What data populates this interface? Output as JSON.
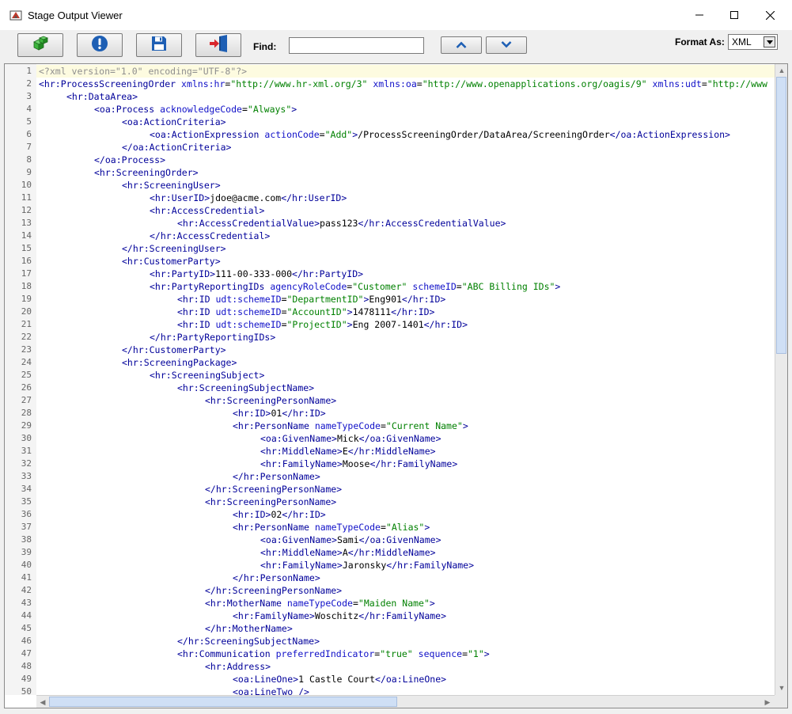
{
  "window": {
    "title": "Stage Output Viewer"
  },
  "toolbar": {
    "find_label": "Find:",
    "find_value": "",
    "format_label": "Format As:",
    "format_value": "XML"
  },
  "editor": {
    "lines": [
      {
        "n": "1",
        "indent": 0,
        "segs": [
          [
            "p",
            "<?xml version=\"1.0\" encoding=\"UTF-8\"?>"
          ]
        ]
      },
      {
        "n": "2",
        "indent": 0,
        "segs": [
          [
            "t",
            "<hr:ProcessScreeningOrder "
          ],
          [
            "a",
            "xmlns:hr"
          ],
          [
            "x",
            "="
          ],
          [
            "v",
            "\"http://www.hr-xml.org/3\""
          ],
          [
            "x",
            " "
          ],
          [
            "a",
            "xmlns:oa"
          ],
          [
            "x",
            "="
          ],
          [
            "v",
            "\"http://www.openapplications.org/oagis/9\""
          ],
          [
            "x",
            " "
          ],
          [
            "a",
            "xmlns:udt"
          ],
          [
            "x",
            "="
          ],
          [
            "v",
            "\"http://www"
          ]
        ]
      },
      {
        "n": "3",
        "indent": 1,
        "segs": [
          [
            "t",
            "<hr:DataArea>"
          ]
        ]
      },
      {
        "n": "4",
        "indent": 2,
        "segs": [
          [
            "t",
            "<oa:Process "
          ],
          [
            "a",
            "acknowledgeCode"
          ],
          [
            "x",
            "="
          ],
          [
            "v",
            "\"Always\""
          ],
          [
            "t",
            ">"
          ]
        ]
      },
      {
        "n": "5",
        "indent": 3,
        "segs": [
          [
            "t",
            "<oa:ActionCriteria>"
          ]
        ]
      },
      {
        "n": "6",
        "indent": 4,
        "segs": [
          [
            "t",
            "<oa:ActionExpression "
          ],
          [
            "a",
            "actionCode"
          ],
          [
            "x",
            "="
          ],
          [
            "v",
            "\"Add\""
          ],
          [
            "t",
            ">"
          ],
          [
            "x",
            "/ProcessScreeningOrder/DataArea/ScreeningOrder"
          ],
          [
            "t",
            "</oa:ActionExpression>"
          ]
        ]
      },
      {
        "n": "7",
        "indent": 3,
        "segs": [
          [
            "t",
            "</oa:ActionCriteria>"
          ]
        ]
      },
      {
        "n": "8",
        "indent": 2,
        "segs": [
          [
            "t",
            "</oa:Process>"
          ]
        ]
      },
      {
        "n": "9",
        "indent": 2,
        "segs": [
          [
            "t",
            "<hr:ScreeningOrder>"
          ]
        ]
      },
      {
        "n": "10",
        "indent": 3,
        "segs": [
          [
            "t",
            "<hr:ScreeningUser>"
          ]
        ]
      },
      {
        "n": "11",
        "indent": 4,
        "segs": [
          [
            "t",
            "<hr:UserID>"
          ],
          [
            "x",
            "jdoe@acme.com"
          ],
          [
            "t",
            "</hr:UserID>"
          ]
        ]
      },
      {
        "n": "12",
        "indent": 4,
        "segs": [
          [
            "t",
            "<hr:AccessCredential>"
          ]
        ]
      },
      {
        "n": "13",
        "indent": 5,
        "segs": [
          [
            "t",
            "<hr:AccessCredentialValue>"
          ],
          [
            "x",
            "pass123"
          ],
          [
            "t",
            "</hr:AccessCredentialValue>"
          ]
        ]
      },
      {
        "n": "14",
        "indent": 4,
        "segs": [
          [
            "t",
            "</hr:AccessCredential>"
          ]
        ]
      },
      {
        "n": "15",
        "indent": 3,
        "segs": [
          [
            "t",
            "</hr:ScreeningUser>"
          ]
        ]
      },
      {
        "n": "16",
        "indent": 3,
        "segs": [
          [
            "t",
            "<hr:CustomerParty>"
          ]
        ]
      },
      {
        "n": "17",
        "indent": 4,
        "segs": [
          [
            "t",
            "<hr:PartyID>"
          ],
          [
            "x",
            "111-00-333-000"
          ],
          [
            "t",
            "</hr:PartyID>"
          ]
        ]
      },
      {
        "n": "18",
        "indent": 4,
        "segs": [
          [
            "t",
            "<hr:PartyReportingIDs "
          ],
          [
            "a",
            "agencyRoleCode"
          ],
          [
            "x",
            "="
          ],
          [
            "v",
            "\"Customer\""
          ],
          [
            "x",
            " "
          ],
          [
            "a",
            "schemeID"
          ],
          [
            "x",
            "="
          ],
          [
            "v",
            "\"ABC Billing IDs\""
          ],
          [
            "t",
            ">"
          ]
        ]
      },
      {
        "n": "19",
        "indent": 5,
        "segs": [
          [
            "t",
            "<hr:ID "
          ],
          [
            "a",
            "udt:schemeID"
          ],
          [
            "x",
            "="
          ],
          [
            "v",
            "\"DepartmentID\""
          ],
          [
            "t",
            ">"
          ],
          [
            "x",
            "Eng901"
          ],
          [
            "t",
            "</hr:ID>"
          ]
        ]
      },
      {
        "n": "20",
        "indent": 5,
        "segs": [
          [
            "t",
            "<hr:ID "
          ],
          [
            "a",
            "udt:schemeID"
          ],
          [
            "x",
            "="
          ],
          [
            "v",
            "\"AccountID\""
          ],
          [
            "t",
            ">"
          ],
          [
            "x",
            "1478111"
          ],
          [
            "t",
            "</hr:ID>"
          ]
        ]
      },
      {
        "n": "21",
        "indent": 5,
        "segs": [
          [
            "t",
            "<hr:ID "
          ],
          [
            "a",
            "udt:schemeID"
          ],
          [
            "x",
            "="
          ],
          [
            "v",
            "\"ProjectID\""
          ],
          [
            "t",
            ">"
          ],
          [
            "x",
            "Eng 2007-1401"
          ],
          [
            "t",
            "</hr:ID>"
          ]
        ]
      },
      {
        "n": "22",
        "indent": 4,
        "segs": [
          [
            "t",
            "</hr:PartyReportingIDs>"
          ]
        ]
      },
      {
        "n": "23",
        "indent": 3,
        "segs": [
          [
            "t",
            "</hr:CustomerParty>"
          ]
        ]
      },
      {
        "n": "24",
        "indent": 3,
        "segs": [
          [
            "t",
            "<hr:ScreeningPackage>"
          ]
        ]
      },
      {
        "n": "25",
        "indent": 4,
        "segs": [
          [
            "t",
            "<hr:ScreeningSubject>"
          ]
        ]
      },
      {
        "n": "26",
        "indent": 5,
        "segs": [
          [
            "t",
            "<hr:ScreeningSubjectName>"
          ]
        ]
      },
      {
        "n": "27",
        "indent": 6,
        "segs": [
          [
            "t",
            "<hr:ScreeningPersonName>"
          ]
        ]
      },
      {
        "n": "28",
        "indent": 7,
        "segs": [
          [
            "t",
            "<hr:ID>"
          ],
          [
            "x",
            "01"
          ],
          [
            "t",
            "</hr:ID>"
          ]
        ]
      },
      {
        "n": "29",
        "indent": 7,
        "segs": [
          [
            "t",
            "<hr:PersonName "
          ],
          [
            "a",
            "nameTypeCode"
          ],
          [
            "x",
            "="
          ],
          [
            "v",
            "\"Current Name\""
          ],
          [
            "t",
            ">"
          ]
        ]
      },
      {
        "n": "30",
        "indent": 8,
        "segs": [
          [
            "t",
            "<oa:GivenName>"
          ],
          [
            "x",
            "Mick"
          ],
          [
            "t",
            "</oa:GivenName>"
          ]
        ]
      },
      {
        "n": "31",
        "indent": 8,
        "segs": [
          [
            "t",
            "<hr:MiddleName>"
          ],
          [
            "x",
            "E"
          ],
          [
            "t",
            "</hr:MiddleName>"
          ]
        ]
      },
      {
        "n": "32",
        "indent": 8,
        "segs": [
          [
            "t",
            "<hr:FamilyName>"
          ],
          [
            "x",
            "Moose"
          ],
          [
            "t",
            "</hr:FamilyName>"
          ]
        ]
      },
      {
        "n": "33",
        "indent": 7,
        "segs": [
          [
            "t",
            "</hr:PersonName>"
          ]
        ]
      },
      {
        "n": "34",
        "indent": 6,
        "segs": [
          [
            "t",
            "</hr:ScreeningPersonName>"
          ]
        ]
      },
      {
        "n": "35",
        "indent": 6,
        "segs": [
          [
            "t",
            "<hr:ScreeningPersonName>"
          ]
        ]
      },
      {
        "n": "36",
        "indent": 7,
        "segs": [
          [
            "t",
            "<hr:ID>"
          ],
          [
            "x",
            "02"
          ],
          [
            "t",
            "</hr:ID>"
          ]
        ]
      },
      {
        "n": "37",
        "indent": 7,
        "segs": [
          [
            "t",
            "<hr:PersonName "
          ],
          [
            "a",
            "nameTypeCode"
          ],
          [
            "x",
            "="
          ],
          [
            "v",
            "\"Alias\""
          ],
          [
            "t",
            ">"
          ]
        ]
      },
      {
        "n": "38",
        "indent": 8,
        "segs": [
          [
            "t",
            "<oa:GivenName>"
          ],
          [
            "x",
            "Sami"
          ],
          [
            "t",
            "</oa:GivenName>"
          ]
        ]
      },
      {
        "n": "39",
        "indent": 8,
        "segs": [
          [
            "t",
            "<hr:MiddleName>"
          ],
          [
            "x",
            "A"
          ],
          [
            "t",
            "</hr:MiddleName>"
          ]
        ]
      },
      {
        "n": "40",
        "indent": 8,
        "segs": [
          [
            "t",
            "<hr:FamilyName>"
          ],
          [
            "x",
            "Jaronsky"
          ],
          [
            "t",
            "</hr:FamilyName>"
          ]
        ]
      },
      {
        "n": "41",
        "indent": 7,
        "segs": [
          [
            "t",
            "</hr:PersonName>"
          ]
        ]
      },
      {
        "n": "42",
        "indent": 6,
        "segs": [
          [
            "t",
            "</hr:ScreeningPersonName>"
          ]
        ]
      },
      {
        "n": "43",
        "indent": 6,
        "segs": [
          [
            "t",
            "<hr:MotherName "
          ],
          [
            "a",
            "nameTypeCode"
          ],
          [
            "x",
            "="
          ],
          [
            "v",
            "\"Maiden Name\""
          ],
          [
            "t",
            ">"
          ]
        ]
      },
      {
        "n": "44",
        "indent": 7,
        "segs": [
          [
            "t",
            "<hr:FamilyName>"
          ],
          [
            "x",
            "Woschitz"
          ],
          [
            "t",
            "</hr:FamilyName>"
          ]
        ]
      },
      {
        "n": "45",
        "indent": 6,
        "segs": [
          [
            "t",
            "</hr:MotherName>"
          ]
        ]
      },
      {
        "n": "46",
        "indent": 5,
        "segs": [
          [
            "t",
            "</hr:ScreeningSubjectName>"
          ]
        ]
      },
      {
        "n": "47",
        "indent": 5,
        "segs": [
          [
            "t",
            "<hr:Communication "
          ],
          [
            "a",
            "preferredIndicator"
          ],
          [
            "x",
            "="
          ],
          [
            "v",
            "\"true\""
          ],
          [
            "x",
            " "
          ],
          [
            "a",
            "sequence"
          ],
          [
            "x",
            "="
          ],
          [
            "v",
            "\"1\""
          ],
          [
            "t",
            ">"
          ]
        ]
      },
      {
        "n": "48",
        "indent": 6,
        "segs": [
          [
            "t",
            "<hr:Address>"
          ]
        ]
      },
      {
        "n": "49",
        "indent": 7,
        "segs": [
          [
            "t",
            "<oa:LineOne>"
          ],
          [
            "x",
            "1 Castle Court"
          ],
          [
            "t",
            "</oa:LineOne>"
          ]
        ]
      },
      {
        "n": "50",
        "indent": 7,
        "segs": [
          [
            "t",
            "<oa:LineTwo />"
          ]
        ]
      }
    ]
  },
  "colors": {
    "tag": "#00009a",
    "attribute": "#1010c8",
    "value": "#008000",
    "prolog": "#8f8f8f",
    "accent": "#1e5fb4"
  }
}
